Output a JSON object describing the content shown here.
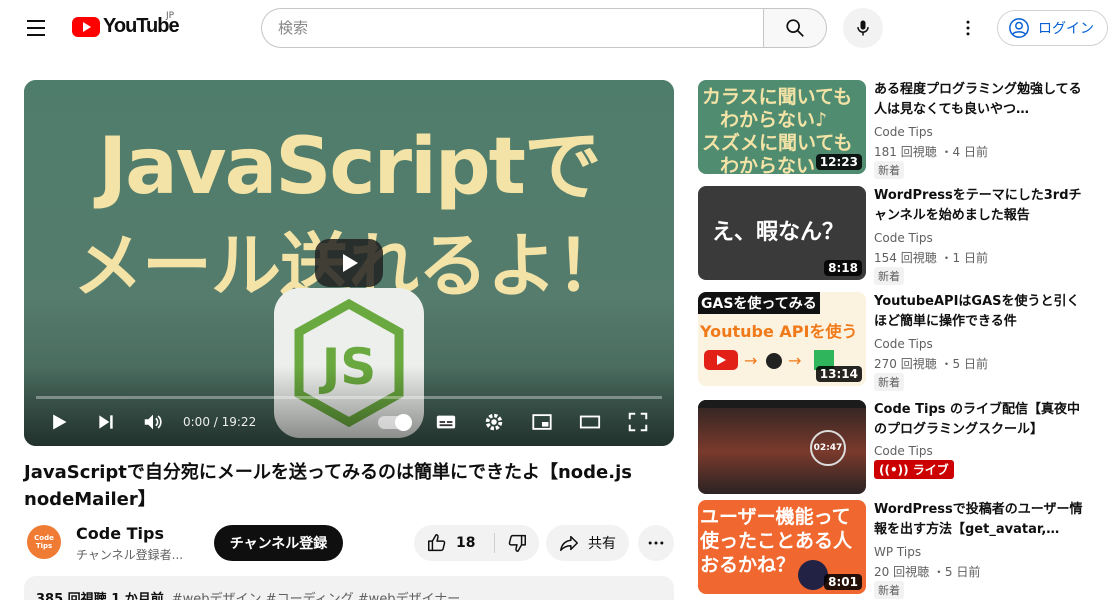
{
  "header": {
    "logo_text": "YouTube",
    "country_code": "JP",
    "search_placeholder": "検索",
    "login_label": "ログイン"
  },
  "player": {
    "thumbnail_line1": "JavaScriptで",
    "thumbnail_line2": "メール送れるよ！",
    "node_logo_text": "JS",
    "time_display": "0:00 / 19:22",
    "progress": 0
  },
  "video": {
    "title": "JavaScriptで自分宛にメールを送ってみるのは簡単にできたよ【node.js nodeMailer】",
    "channel_name": "Code Tips",
    "channel_subs": "チャンネル登録者...",
    "avatar_text_line1": "Code",
    "avatar_text_line2": "Tips",
    "subscribe_label": "チャンネル登録",
    "like_count": "18",
    "share_label": "共有",
    "description_views": "385 回視聴  1 か月前",
    "description_tags": "#webデザイン #コーディング #webデザイナー"
  },
  "recommendations": [
    {
      "title": "ある程度プログラミング勉強してる人は見なくても良いやつ…",
      "channel": "Code Tips",
      "meta": "181 回視聴 ・4 日前",
      "badge": "新着",
      "duration": "12:23",
      "thumb_lines": [
        "カラスに聞いても",
        "わからない♪",
        "スズメに聞いても",
        "わからない"
      ],
      "thumb_bg": "#4f8c70"
    },
    {
      "title": "WordPressをテーマにした3rdチャンネルを始めました報告",
      "channel": "Code Tips",
      "meta": "154 回視聴 ・1 日前",
      "badge": "新着",
      "duration": "8:18",
      "thumb_lines": [
        "え、暇なん？"
      ],
      "thumb_bg": "#3a3a3a"
    },
    {
      "title": "YoutubeAPIはGASを使うと引くほど簡単に操作できる件",
      "channel": "Code Tips",
      "meta": "270 回視聴 ・5 日前",
      "badge": "新着",
      "duration": "13:14",
      "thumb_lines": [
        "GASを使ってみる",
        "Youtube APIを使う"
      ],
      "thumb_bg": "#fbf3df"
    },
    {
      "title": "Code Tips のライブ配信【真夜中のプログラミングスクール】",
      "channel": "Code Tips",
      "live_label": "ライブ",
      "clock_text": "02:47",
      "thumb_bg": "#2b2323"
    },
    {
      "title": "WordPressで投稿者のユーザー情報を出す方法【get_avatar,…",
      "channel": "WP Tips",
      "meta": "20 回視聴 ・5 日前",
      "badge": "新着",
      "duration": "8:01",
      "thumb_lines": [
        "ユーザー機能って",
        "使ったことある人",
        "おるかね？"
      ],
      "thumb_bg": "#f0682f"
    }
  ],
  "colors": {
    "brand_red": "#ff0000",
    "link_blue": "#065fd4",
    "thumb_text": "#f4e3a6",
    "player_bg": "#527b6b",
    "node_green": "#6aa93f"
  }
}
